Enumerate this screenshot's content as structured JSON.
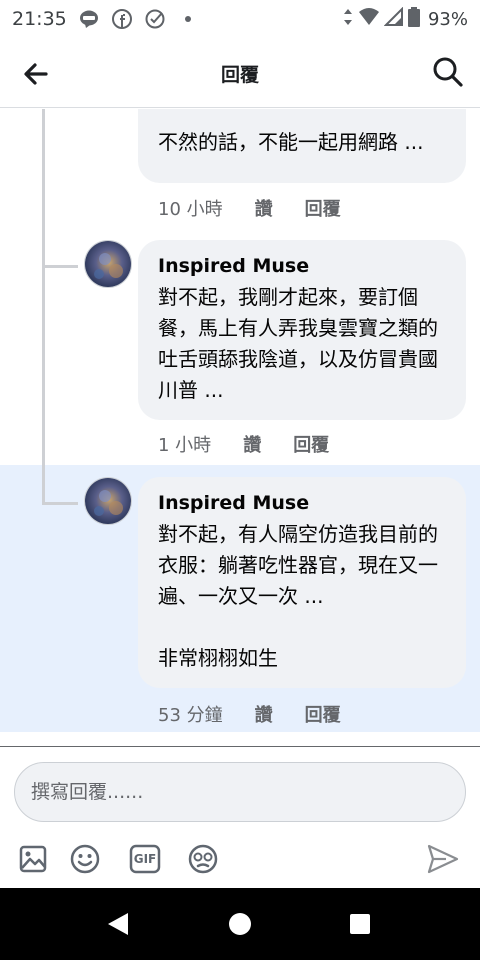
{
  "status_bar": {
    "time": "21:35",
    "battery": "93%",
    "icons": [
      "line-icon",
      "facebook-icon",
      "check-circle-icon",
      "dot-icon",
      "data-arrows-icon",
      "wifi-icon",
      "signal-icon",
      "battery-icon"
    ]
  },
  "header": {
    "title": "回覆",
    "back_icon": "back-arrow-icon",
    "search_icon": "search-icon"
  },
  "comments": [
    {
      "name": "",
      "text": "不然的話，不能一起用網路 ...",
      "time": "10 小時",
      "like": "讚",
      "reply": "回覆"
    },
    {
      "name": "Inspired Muse",
      "text": "對不起，我剛才起來，要訂個餐，馬上有人弄我臭雲寶之類的吐舌頭舔我陰道，以及仿冒貴國川普 ...",
      "time": "1 小時",
      "like": "讚",
      "reply": "回覆"
    },
    {
      "name": "Inspired Muse",
      "text": "對不起，有人隔空仿造我目前的衣服：躺著吃性器官，現在又一遍、一次又一次 ...",
      "text2": "非常栩栩如生",
      "time": "53 分鐘",
      "like": "讚",
      "reply": "回覆"
    }
  ],
  "composer": {
    "placeholder": "撰寫回覆......"
  },
  "toolbar": {
    "icons": [
      "photo-icon",
      "emoji-icon",
      "gif-icon",
      "sticker-icon",
      "send-icon"
    ],
    "gif_label": "GIF"
  },
  "colors": {
    "highlight": "#e7f0fd",
    "bubble": "#f0f2f5",
    "meta": "#65676b",
    "navbar": "#000000"
  }
}
